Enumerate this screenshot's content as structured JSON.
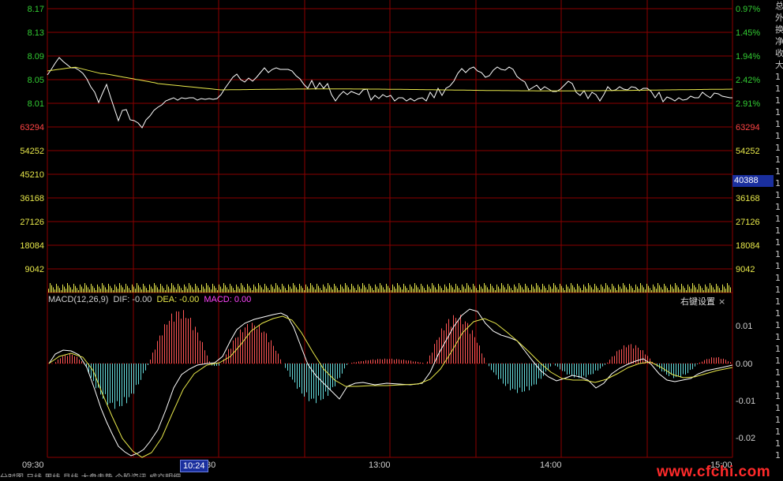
{
  "price_axis": {
    "left_labels": [
      "8.17",
      "8.13",
      "8.09",
      "8.05",
      "8.01"
    ],
    "right_labels": [
      "0.97%",
      "1.45%",
      "1.94%",
      "2.42%",
      "2.91%"
    ]
  },
  "volume_axis": {
    "labels": [
      "63294",
      "54252",
      "45210",
      "36168",
      "27126",
      "18084",
      "9042"
    ],
    "current_value": "40388"
  },
  "macd_axis": {
    "labels": [
      "0.01",
      "0.00",
      "-0.01",
      "-0.02"
    ]
  },
  "macd_legend": {
    "name": "MACD(12,26,9)",
    "dif_label": "DIF: -0.00",
    "dea_label": "DEA: -0.00",
    "macd_label": "MACD: 0.00",
    "settings_label": "右键设置",
    "close_label": "×"
  },
  "time_axis": {
    "labels": [
      "09:30",
      "13:00",
      "14:00",
      "15:00"
    ],
    "partial_label": "30",
    "cursor_time": "10:24"
  },
  "side_panel": [
    "总",
    "外",
    "换",
    "净",
    "收",
    "大",
    "1",
    "1",
    "1",
    "1",
    "1",
    "1",
    "1",
    "1",
    "1",
    "1",
    "1",
    "1",
    "1",
    "1",
    "1",
    "1",
    "1",
    "1",
    "1",
    "1",
    "1",
    "1",
    "1",
    "1",
    "1",
    "1",
    "1",
    "1",
    "1",
    "1",
    "1",
    "1",
    "1"
  ],
  "bottom_tabs": "分时图  日线  周线  月线  大盘走势  个股资讯  成交明细",
  "watermark": "www.cfchi.com",
  "colors": {
    "grid": "#8b0000",
    "price_line": "#ffffff",
    "avg_line": "#e8e84a",
    "volume_bar": "#e8e84a",
    "macd_up": "#ff5555",
    "macd_down": "#66dddd",
    "dif_line": "#ffffff",
    "dea_line": "#e8e84a",
    "axis_green": "#33cc33",
    "axis_red": "#ff4444",
    "macd_text": "#ff44ff"
  }
}
